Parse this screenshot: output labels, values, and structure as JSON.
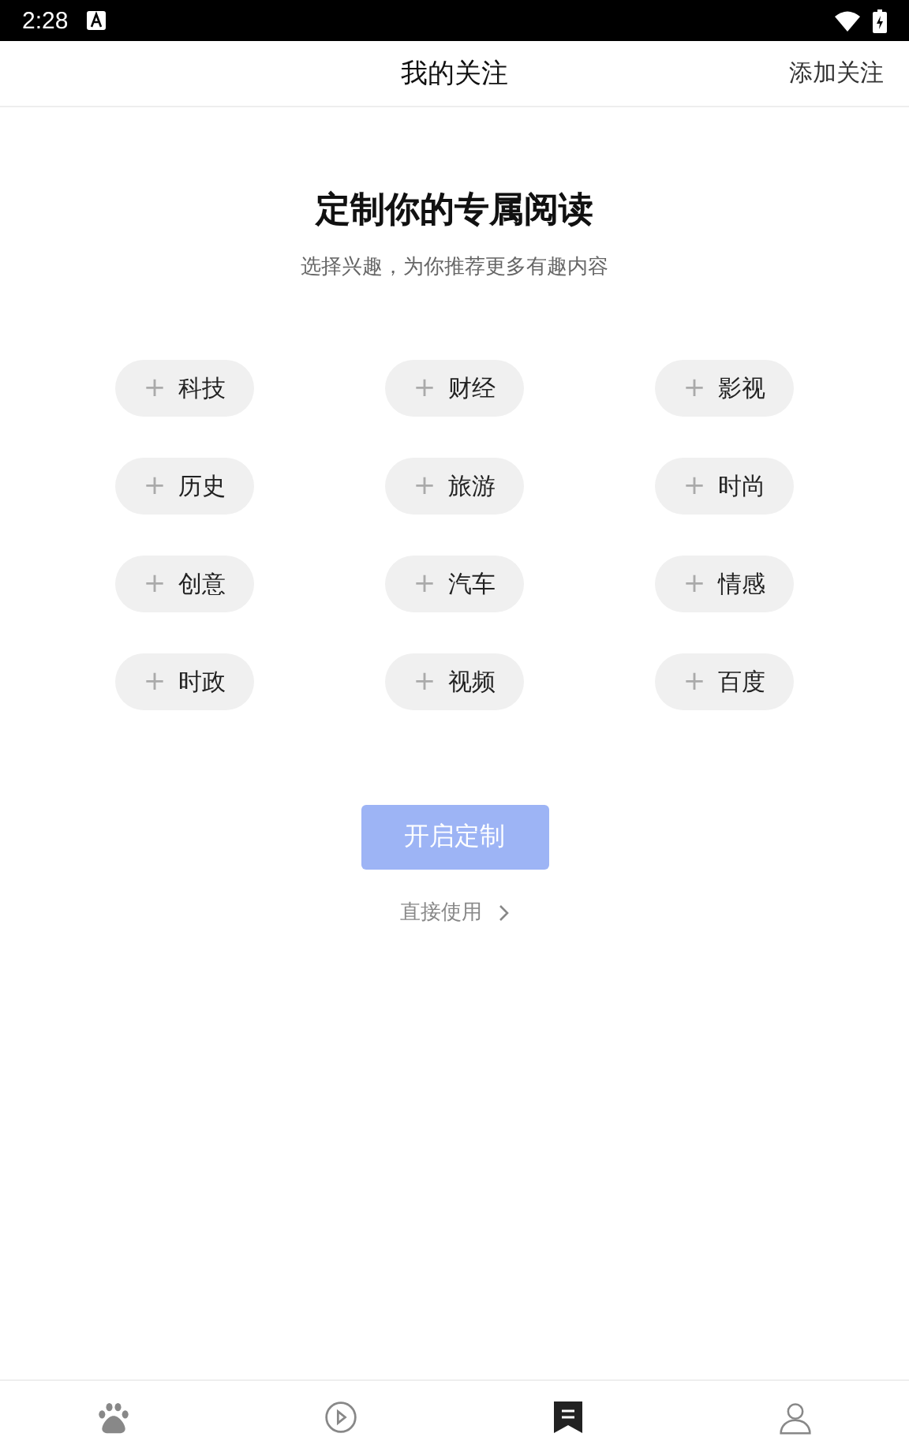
{
  "status_bar": {
    "time": "2:28"
  },
  "header": {
    "title": "我的关注",
    "action": "添加关注"
  },
  "intro": {
    "title": "定制你的专属阅读",
    "subtitle": "选择兴趣，为你推荐更多有趣内容"
  },
  "topics": [
    {
      "icon": "+",
      "label": "科技",
      "selected": false
    },
    {
      "icon": "+",
      "label": "财经",
      "selected": false
    },
    {
      "icon": "+",
      "label": "影视",
      "selected": false
    },
    {
      "icon": "+",
      "label": "历史",
      "selected": false
    },
    {
      "icon": "+",
      "label": "旅游",
      "selected": false
    },
    {
      "icon": "+",
      "label": "时尚",
      "selected": false
    },
    {
      "icon": "+",
      "label": "创意",
      "selected": false
    },
    {
      "icon": "+",
      "label": "汽车",
      "selected": false
    },
    {
      "icon": "+",
      "label": "情感",
      "selected": false
    },
    {
      "icon": "+",
      "label": "时政",
      "selected": false
    },
    {
      "icon": "+",
      "label": "视频",
      "selected": false
    },
    {
      "icon": "+",
      "label": "百度",
      "selected": false
    }
  ],
  "start_button": {
    "label": "开启定制",
    "disabled": true
  },
  "skip_link": {
    "label": "直接使用"
  },
  "bottom_nav": [
    {
      "kind": "paw",
      "selected": false
    },
    {
      "kind": "play",
      "selected": false
    },
    {
      "kind": "bookmark",
      "selected": true
    },
    {
      "kind": "person",
      "selected": false
    }
  ]
}
